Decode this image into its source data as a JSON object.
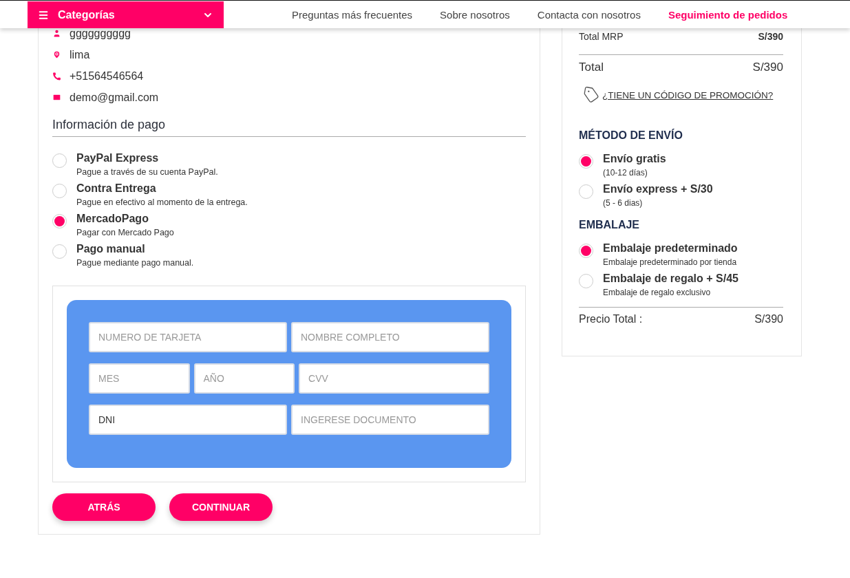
{
  "header": {
    "categories_button": "Categorías",
    "nav": [
      {
        "label": "Preguntas más frecuentes",
        "selected": false
      },
      {
        "label": "Sobre nosotros",
        "selected": false
      },
      {
        "label": "Contacta con nosotros",
        "selected": false
      },
      {
        "label": "Seguimiento de pedidos",
        "selected": true
      }
    ]
  },
  "contact": [
    {
      "kind": "user",
      "text": "gggggggggg"
    },
    {
      "kind": "location",
      "text": "lima"
    },
    {
      "kind": "phone",
      "text": "+51564546564"
    },
    {
      "kind": "email",
      "text": "demo@gmail.com"
    }
  ],
  "payment": {
    "title": "Información de pago",
    "methods": [
      {
        "name": "PayPal Express",
        "description": "Pague a través de su cuenta PayPal.",
        "selected": false
      },
      {
        "name": "Contra Entrega",
        "description": "Pague en efectivo al momento de la entrega.",
        "selected": false
      },
      {
        "name": "MercadoPago",
        "description": "Pagar con Mercado Pago",
        "selected": true
      },
      {
        "name": "Pago manual",
        "description": "Pague mediante pago manual.",
        "selected": false
      }
    ],
    "card_form": [
      [
        {
          "kind": "text",
          "placeholder": "NUMERO DE TARJETA"
        },
        {
          "kind": "text",
          "placeholder": "NOMBRE COMPLETO"
        }
      ],
      [
        {
          "kind": "text",
          "placeholder": "MES"
        },
        {
          "kind": "text",
          "placeholder": "AÑO"
        },
        {
          "kind": "text",
          "placeholder": "CVV"
        }
      ],
      [
        {
          "kind": "select",
          "value": "DNI"
        },
        {
          "kind": "text",
          "placeholder": "INGERESE DOCUMENTO"
        }
      ]
    ]
  },
  "buttons": [
    "ATRÁS",
    "CONTINUAR"
  ],
  "summary": {
    "total_mrp": {
      "label": "Total MRP",
      "value": "S/390"
    },
    "total": {
      "label": "Total",
      "value": "S/390"
    },
    "promo_link": "¿TIENE UN CÓDIGO DE PROMOCIÓN?",
    "sections": [
      {
        "title": "MÉTODO DE ENVÍO",
        "options": [
          {
            "name": "Envío gratis",
            "description": "(10-12 días)",
            "selected": true
          },
          {
            "name": "Envío express + S/30",
            "description": "(5 - 6 dias)",
            "selected": false
          }
        ]
      },
      {
        "title": "EMBALAJE",
        "options": [
          {
            "name": "Embalaje predeterminado",
            "description": "Embalaje predeterminado por tienda",
            "selected": true
          },
          {
            "name": "Embalaje de regalo + S/45",
            "description": "Embalaje de regalo exclusivo",
            "selected": false
          }
        ]
      }
    ],
    "price_total": {
      "label": "Precio Total :",
      "value": "S/390"
    }
  }
}
